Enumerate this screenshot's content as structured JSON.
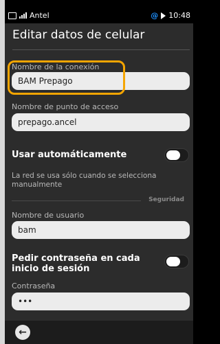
{
  "status_bar": {
    "carrier": "Antel",
    "time": "10:48",
    "icons": [
      "sim-icon",
      "signal-icon",
      "at-icon",
      "play-icon"
    ]
  },
  "page": {
    "title": "Editar datos de celular"
  },
  "connection_name": {
    "label": "Nombre de la conexión",
    "value": "BAM Prepago"
  },
  "apn": {
    "label": "Nombre de punto de acceso",
    "value": "prepago.ancel"
  },
  "auto_use": {
    "title": "Usar automáticamente",
    "description": "La red se usa sólo cuando se selecciona manualmente",
    "enabled": false
  },
  "security": {
    "section_label": "Seguridad",
    "username_label": "Nombre de usuario",
    "username_value": "bam",
    "ask_password_title": "Pedir contraseña en cada inicio de sesión",
    "ask_password_enabled": false,
    "password_label": "Contraseña",
    "password_value": "•••"
  },
  "nav": {
    "back_icon": "arrow-left-icon"
  },
  "colors": {
    "highlight": "#f5a500",
    "at_icon": "#1e90ff"
  }
}
